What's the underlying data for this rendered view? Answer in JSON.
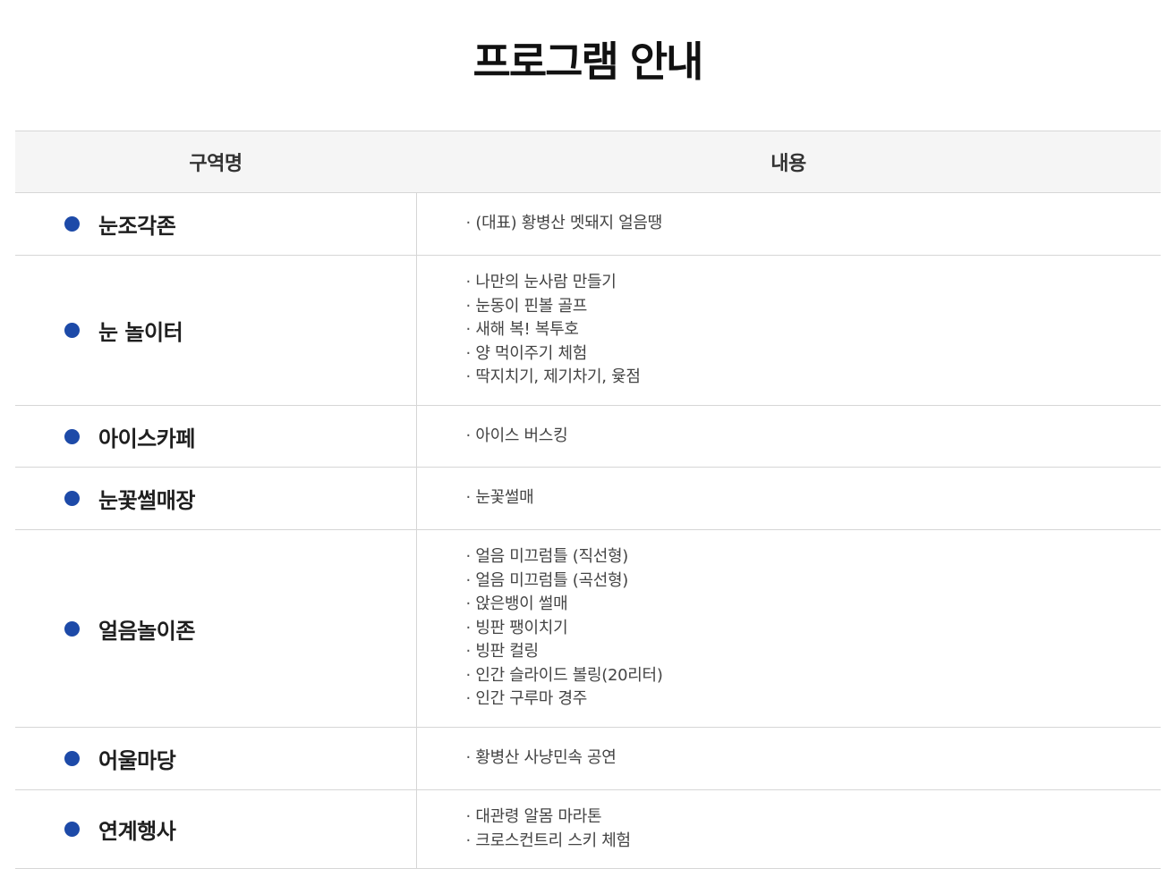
{
  "page": {
    "title": "프로그램 안내"
  },
  "table": {
    "headers": {
      "zone": "구역명",
      "content": "내용"
    },
    "rows": [
      {
        "zone": "눈조각존",
        "items": [
          "(대표) 황병산 멧돼지 얼음땡"
        ]
      },
      {
        "zone": "눈 놀이터",
        "items": [
          "나만의 눈사람 만들기",
          "눈동이 핀볼 골프",
          "새해 복! 복투호",
          "양 먹이주기 체험",
          "딱지치기, 제기차기, 윷점"
        ]
      },
      {
        "zone": "아이스카페",
        "items": [
          "아이스 버스킹"
        ]
      },
      {
        "zone": "눈꽃썰매장",
        "items": [
          "눈꽃썰매"
        ]
      },
      {
        "zone": "얼음놀이존",
        "items": [
          "얼음 미끄럼틀 (직선형)",
          "얼음 미끄럼틀 (곡선형)",
          "앉은뱅이 썰매",
          "빙판 팽이치기",
          "빙판 컬링",
          "인간 슬라이드 볼링(20리터)",
          "인간 구루마 경주"
        ]
      },
      {
        "zone": "어울마당",
        "items": [
          "황병산 사냥민속 공연"
        ]
      },
      {
        "zone": "연계행사",
        "items": [
          "대관령 알몸 마라톤",
          "크로스컨트리 스키 체험"
        ]
      }
    ]
  },
  "colors": {
    "bullet": "#1d4aa8",
    "header_bg": "#f5f5f5",
    "border": "#d6d6d6"
  }
}
